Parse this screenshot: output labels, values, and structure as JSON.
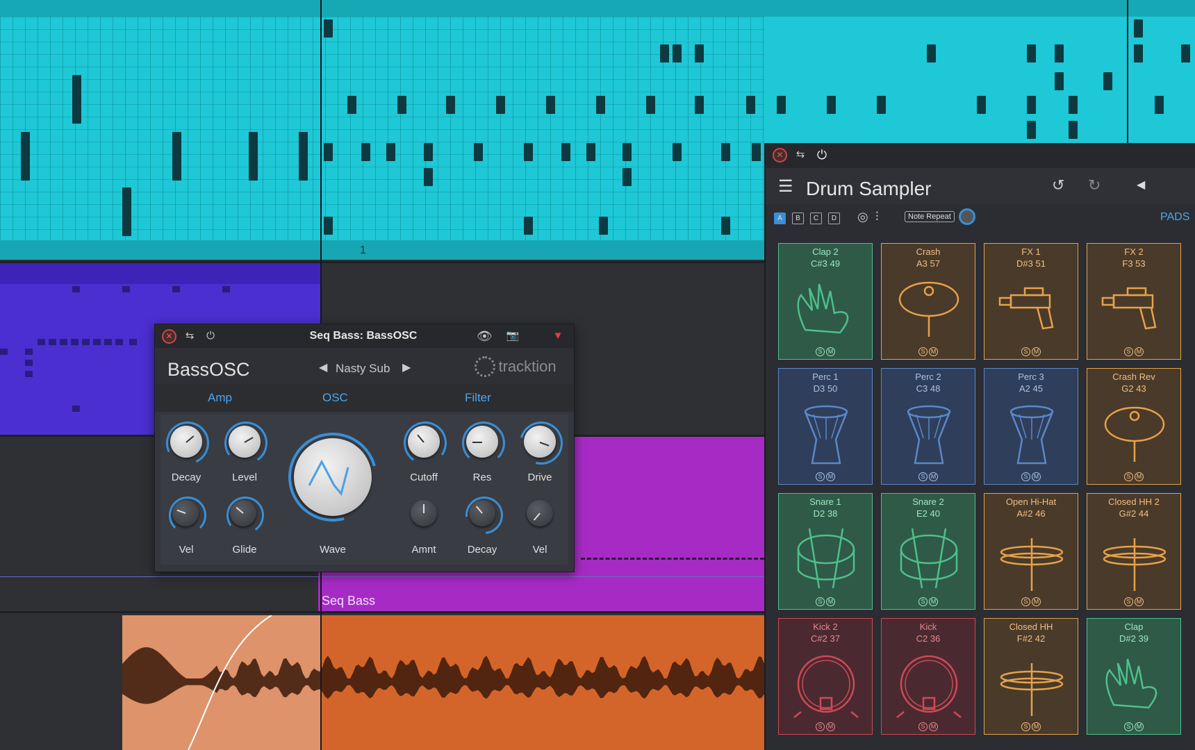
{
  "arrangement": {
    "bar_marker": "1",
    "clip_label": "Seq Bass"
  },
  "bass_osc": {
    "window_title": "Seq Bass: BassOSC",
    "plugin_name": "BassOSC",
    "preset": "Nasty Sub",
    "brand": "tracktion",
    "tabs": [
      "Amp",
      "OSC",
      "Filter"
    ],
    "knobs_top": [
      "Decay",
      "Level",
      "Cutoff",
      "Res",
      "Drive"
    ],
    "knobs_bottom": [
      "Vel",
      "Glide",
      "Amnt",
      "Decay",
      "Vel"
    ],
    "wave_label": "Wave"
  },
  "drum_sampler": {
    "title": "Drum Sampler",
    "banks": [
      "A",
      "B",
      "C",
      "D"
    ],
    "note_repeat": "Note Repeat",
    "pads_label": "PADS",
    "solo_label": "S",
    "mute_label": "M",
    "pads": [
      {
        "name": "Clap 2",
        "note": "C#3  49",
        "color": "green",
        "icon": "clap-icon"
      },
      {
        "name": "Crash",
        "note": "A3  57",
        "color": "orange",
        "icon": "crash-cymbal-icon"
      },
      {
        "name": "FX 1",
        "note": "D#3  51",
        "color": "orange",
        "icon": "ray-gun-icon"
      },
      {
        "name": "FX 2",
        "note": "F3  53",
        "color": "orange",
        "icon": "ray-gun-icon"
      },
      {
        "name": "Perc 1",
        "note": "D3  50",
        "color": "blue",
        "icon": "djembe-icon"
      },
      {
        "name": "Perc 2",
        "note": "C3  48",
        "color": "blue",
        "icon": "djembe-icon"
      },
      {
        "name": "Perc 3",
        "note": "A2  45",
        "color": "blue",
        "icon": "djembe-icon"
      },
      {
        "name": "Crash Rev",
        "note": "G2  43",
        "color": "orange",
        "icon": "crash-cymbal-icon"
      },
      {
        "name": "Snare 1",
        "note": "D2  38",
        "color": "green",
        "icon": "snare-icon"
      },
      {
        "name": "Snare 2",
        "note": "E2  40",
        "color": "green",
        "icon": "snare-icon"
      },
      {
        "name": "Open Hi-Hat",
        "note": "A#2  46",
        "color": "orange",
        "icon": "hihat-icon"
      },
      {
        "name": "Closed HH 2",
        "note": "G#2  44",
        "color": "orange",
        "icon": "hihat-icon"
      },
      {
        "name": "Kick 2",
        "note": "C#2  37",
        "color": "red",
        "icon": "kick-drum-icon"
      },
      {
        "name": "Kick",
        "note": "C2  36",
        "color": "red",
        "icon": "kick-drum-icon"
      },
      {
        "name": "Closed HH",
        "note": "F#2  42",
        "color": "orange",
        "icon": "hihat-icon"
      },
      {
        "name": "Clap",
        "note": "D#2  39",
        "color": "green",
        "icon": "clap-icon"
      }
    ]
  },
  "colors": {
    "midi_clip": "#1ec8d6",
    "purple_clip": "#4b2fd0",
    "magenta_clip": "#a62bc4",
    "audio_clip": "#d4652a",
    "accent": "#3a8fd6"
  }
}
